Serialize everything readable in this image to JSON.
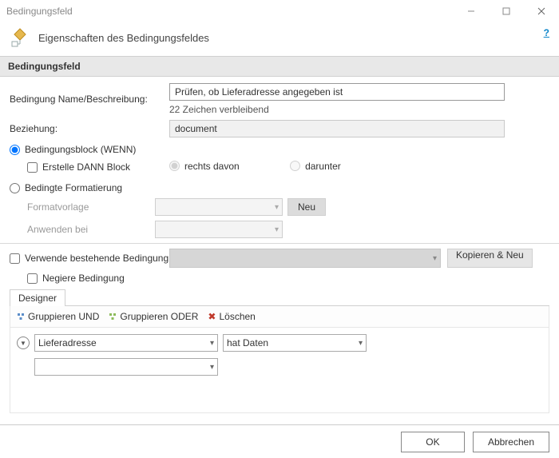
{
  "window": {
    "title": "Bedingungsfeld"
  },
  "header": {
    "title": "Eigenschaften des Bedingungsfeldes",
    "help": "?"
  },
  "section": {
    "title": "Bedingungsfeld"
  },
  "labels": {
    "nameDesc": "Bedingung Name/Beschreibung:",
    "relation": "Beziehung:",
    "blockWenn": "Bedingungsblock (WENN)",
    "createThen": "Erstelle DANN Block",
    "rightOf": "rechts davon",
    "below": "darunter",
    "conditionalFormatting": "Bedingte Formatierung",
    "formatTemplate": "Formatvorlage",
    "applyAt": "Anwenden bei",
    "newBtn": "Neu",
    "useExisting": "Verwende bestehende Bedingung",
    "copyNew": "Kopieren & Neu",
    "negate": "Negiere Bedingung",
    "designerTab": "Designer"
  },
  "values": {
    "nameDesc": "Prüfen, ob Lieferadresse angegeben ist",
    "remainingChars": "22 Zeichen verbleibend",
    "relation": "document"
  },
  "toolbar": {
    "groupAnd": "Gruppieren UND",
    "groupOr": "Gruppieren ODER",
    "delete": "Löschen"
  },
  "designer": {
    "field": "Lieferadresse",
    "operator": "hat Daten"
  },
  "footer": {
    "ok": "OK",
    "cancel": "Abbrechen"
  }
}
